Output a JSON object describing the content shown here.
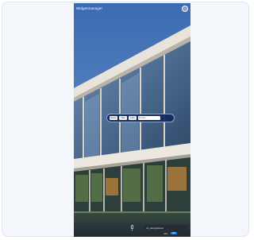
{
  "app": {
    "title": "Widgetmanager"
  },
  "icons": {
    "settings": "gear-icon",
    "microphone": "microphone-icon"
  },
  "widget_toolbar": {
    "buttons": [
      "Raum",
      "Text",
      "Licht"
    ],
    "input_value": "Einsatz"
  },
  "bottom_panel": {
    "message": "Lift_Hauptgebäude",
    "cancel_label": "Abbr.",
    "ok_label": "OK"
  },
  "colors": {
    "sky": "#3e6fae",
    "toolbar_bg": "#14285a",
    "toolbar_border": "#7ea5e0",
    "panel_bg": "#282c34",
    "ok_blue": "#2f7de1"
  }
}
